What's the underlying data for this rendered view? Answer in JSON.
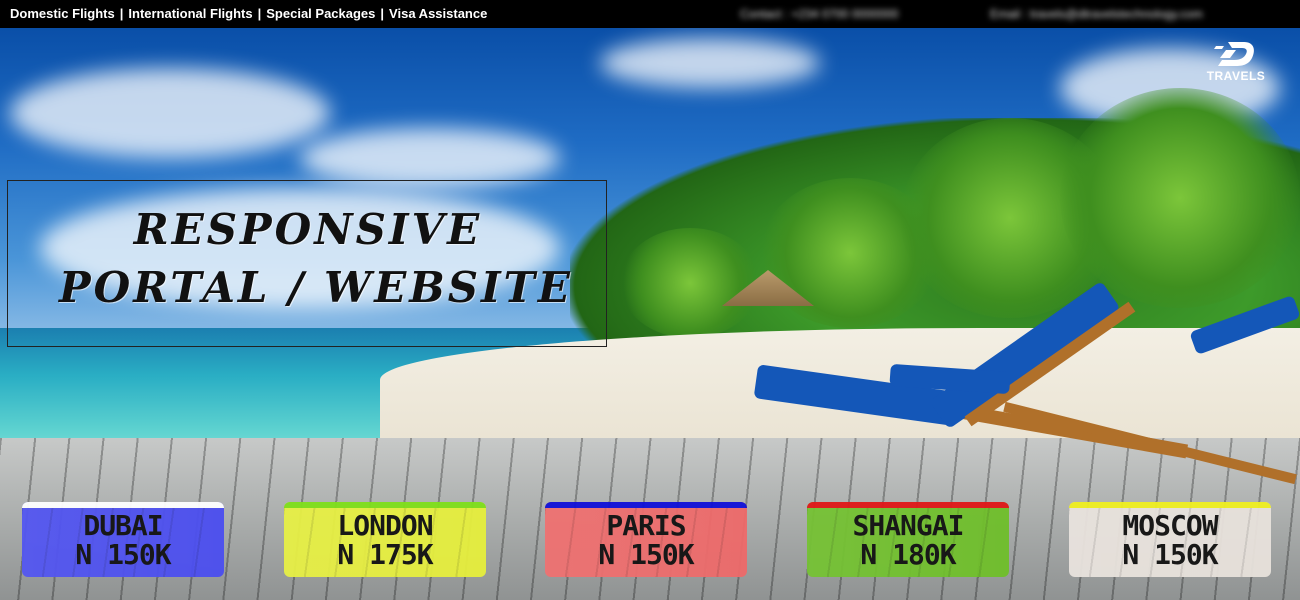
{
  "top_nav": {
    "items": [
      "Domestic Flights",
      "International Flights",
      "Special Packages",
      "Visa Assistance"
    ],
    "separator": "|"
  },
  "contact": {
    "phone": "Contact : +234 0700 0000000",
    "email": "Email : travels@dtravelstechnology.com"
  },
  "headline": {
    "line1": "RESPONSIVE",
    "line2": "PORTAL / WEBSITE"
  },
  "logo": {
    "brand": "TRAVELS",
    "icon": "d-logo-icon"
  },
  "destinations": [
    {
      "city": "DUBAI",
      "price": "N 150K",
      "color": "#4b4ef0",
      "strip": "#ffffff"
    },
    {
      "city": "LONDON",
      "price": "N 175K",
      "color": "#e6ef3c",
      "strip": "#7fe01a"
    },
    {
      "city": "PARIS",
      "price": "N 150K",
      "color": "#ee6a6a",
      "strip": "#1010d8"
    },
    {
      "city": "SHANGAI",
      "price": "N 180K",
      "color": "#6fbf2a",
      "strip": "#e01818"
    },
    {
      "city": "MOSCOW",
      "price": "N 150K",
      "color": "#e8e2dc",
      "strip": "#f0f020"
    }
  ]
}
